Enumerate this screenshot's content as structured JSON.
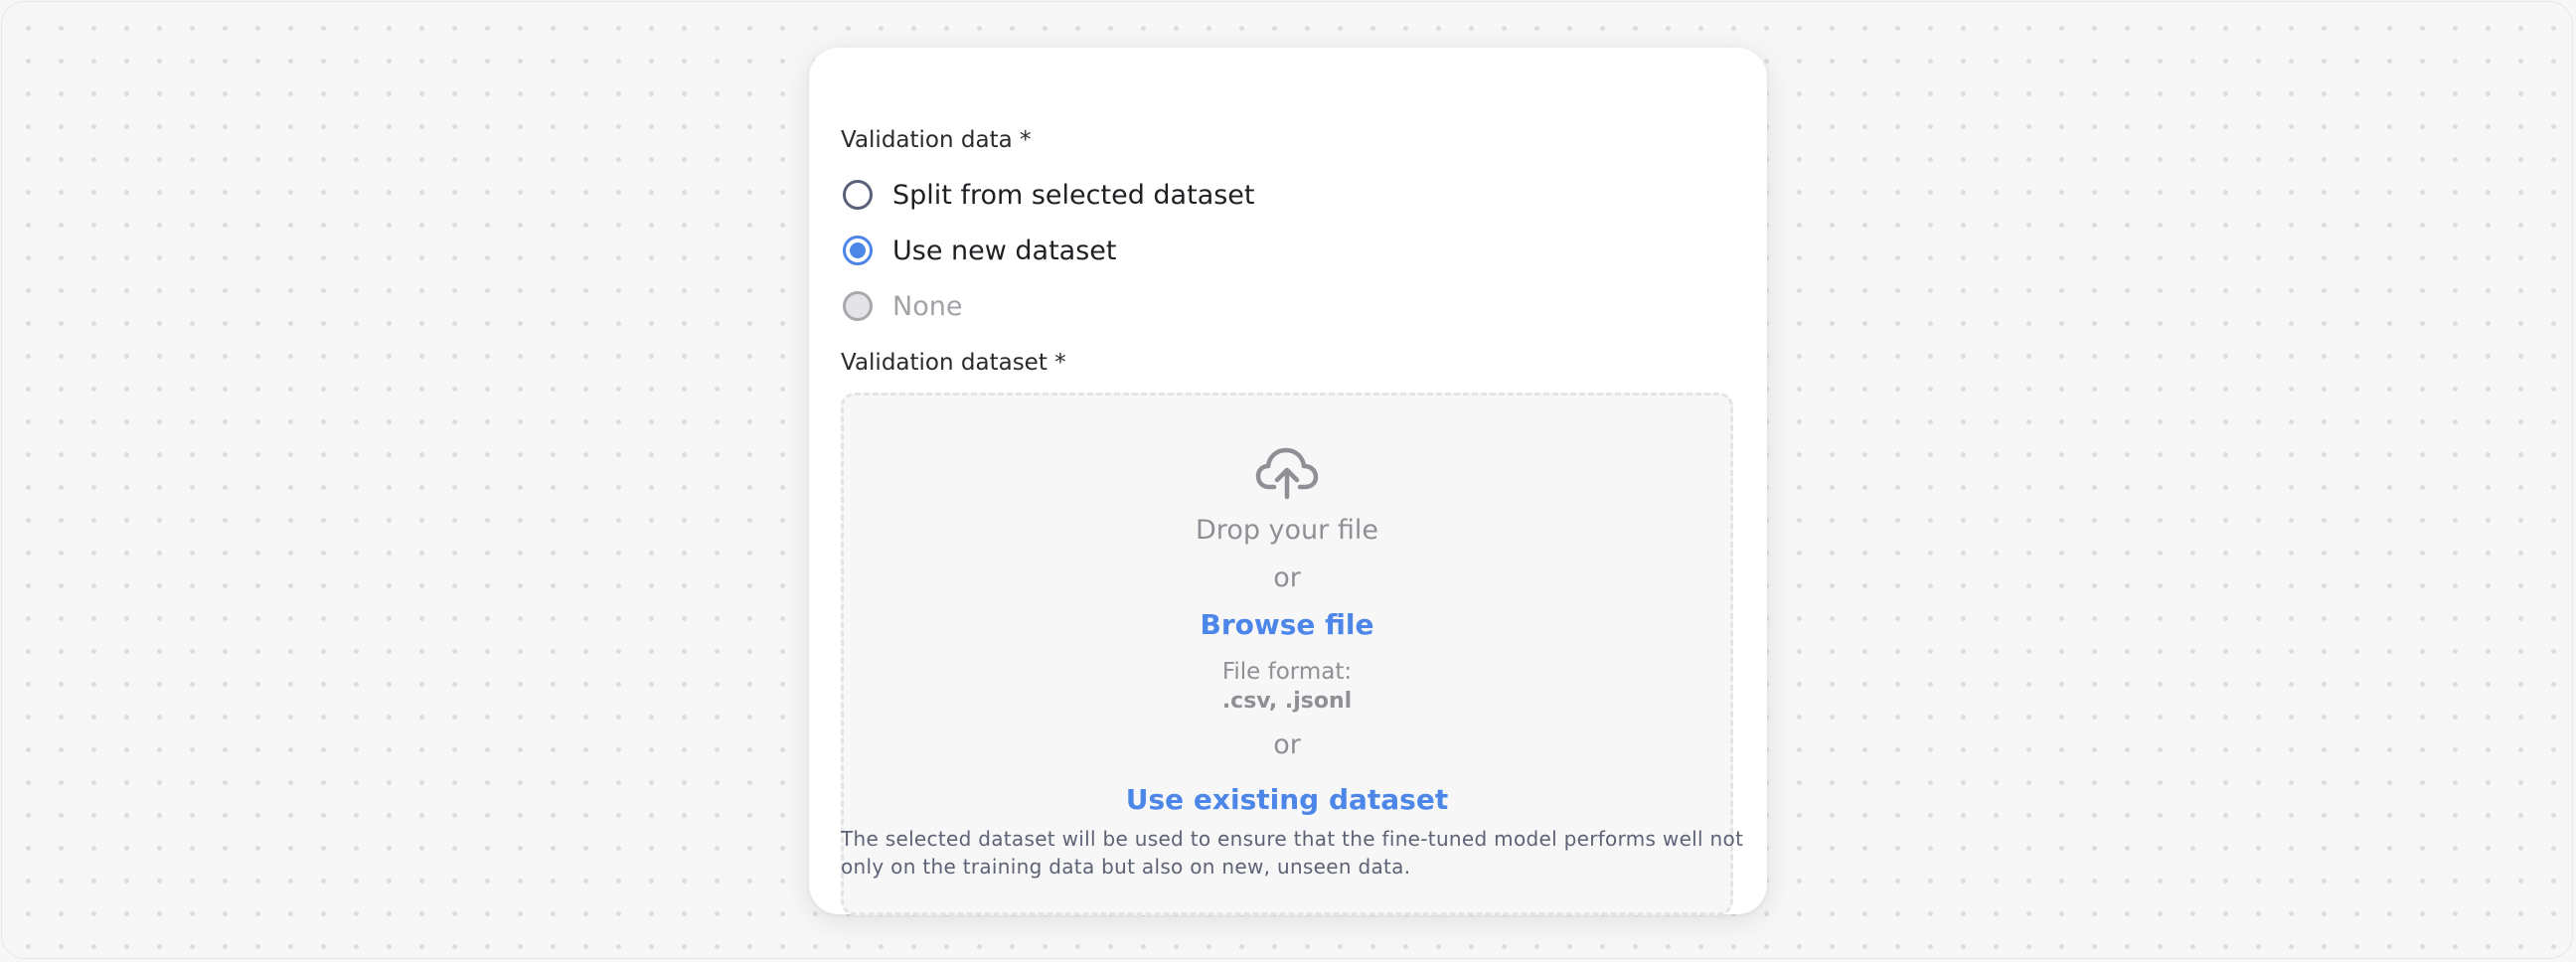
{
  "validation_data": {
    "label": "Validation data *",
    "options": [
      {
        "label": "Split from selected dataset",
        "state": "unchecked"
      },
      {
        "label": "Use new dataset",
        "state": "checked"
      },
      {
        "label": "None",
        "state": "disabled"
      }
    ]
  },
  "validation_dataset": {
    "label": "Validation dataset *",
    "dropzone": {
      "icon": "cloud-upload-icon",
      "drop_text": "Drop your file",
      "or_text_1": "or",
      "browse_label": "Browse file",
      "format_label": "File format:",
      "format_value": ".csv, .jsonl",
      "or_text_2": "or",
      "existing_label": "Use existing dataset"
    },
    "helper_text": "The selected dataset will be used to ensure that the fine-tuned model performs well not only on the training data but also on new, unseen data."
  },
  "colors": {
    "accent": "#4b86e8",
    "muted_text": "#8f8f95",
    "radio_border": "#5b6079"
  }
}
